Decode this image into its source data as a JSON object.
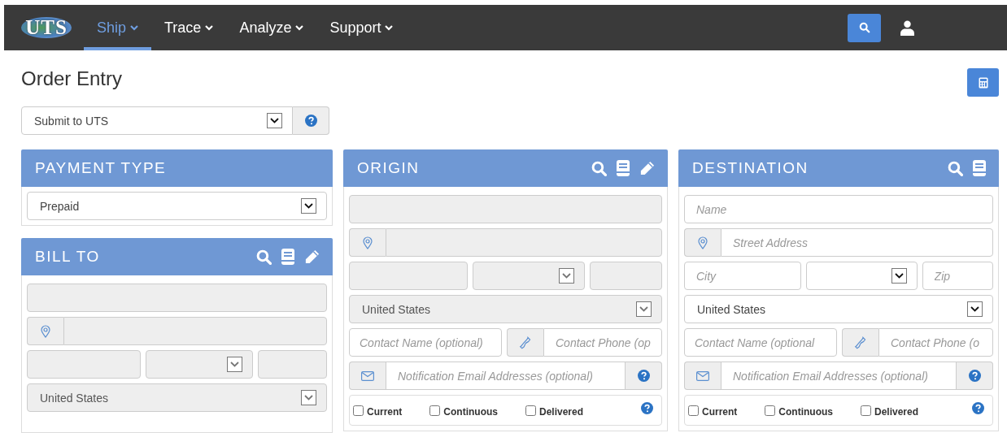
{
  "nav": {
    "logo": "UTS",
    "items": [
      {
        "label": "Ship",
        "selected": true
      },
      {
        "label": "Trace",
        "selected": false
      },
      {
        "label": "Analyze",
        "selected": false
      },
      {
        "label": "Support",
        "selected": false
      }
    ]
  },
  "title": "Order Entry",
  "submit_select": {
    "value": "Submit to UTS"
  },
  "payment_type": {
    "title": "PAYMENT TYPE",
    "select": {
      "value": "Prepaid"
    }
  },
  "panels": [
    {
      "title": "BILL TO",
      "actions": [
        {
          "kind": "search"
        },
        {
          "kind": "book"
        },
        {
          "kind": "edit"
        }
      ],
      "name": {
        "disabled": true
      },
      "street": {
        "disabled": true
      },
      "city": {
        "disabled": true
      },
      "state": {
        "disabled": true
      },
      "zip": {
        "disabled": true
      },
      "country": {
        "value": "United States",
        "disabled": true
      }
    },
    {
      "title": "ORIGIN",
      "actions": [
        {
          "kind": "search"
        },
        {
          "kind": "book"
        },
        {
          "kind": "edit"
        }
      ],
      "name": {
        "disabled": true
      },
      "street": {
        "disabled": true
      },
      "city": {
        "disabled": true
      },
      "state": {
        "disabled": true
      },
      "zip": {
        "disabled": true
      },
      "country": {
        "value": "United States",
        "disabled": true
      },
      "contact_name": {
        "placeholder": "Contact Name (optional)",
        "disabled": false
      },
      "contact_phone": {
        "placeholder": "Contact Phone (op",
        "disabled": false
      },
      "email": {
        "placeholder": "Notification Email Addresses (optional)",
        "disabled": false
      },
      "notify": [
        {
          "label": "Current",
          "checked": false
        },
        {
          "label": "Continuous",
          "checked": false
        },
        {
          "label": "Delivered",
          "checked": false
        }
      ]
    },
    {
      "title": "DESTINATION",
      "actions": [
        {
          "kind": "search"
        },
        {
          "kind": "book"
        }
      ],
      "name": {
        "placeholder": "Name",
        "disabled": false
      },
      "street": {
        "placeholder": "Street Address",
        "disabled": false
      },
      "city": {
        "placeholder": "City",
        "disabled": false
      },
      "state": {
        "disabled": false
      },
      "zip": {
        "placeholder": "Zip",
        "disabled": false
      },
      "country": {
        "value": "United States",
        "disabled": false
      },
      "contact_name": {
        "placeholder": "Contact Name (optional",
        "disabled": false
      },
      "contact_phone": {
        "placeholder": "Contact Phone (o",
        "disabled": false
      },
      "email": {
        "placeholder": "Notification Email Addresses (optional)",
        "disabled": false
      },
      "notify": [
        {
          "label": "Current",
          "checked": false
        },
        {
          "label": "Continuous",
          "checked": false
        },
        {
          "label": "Delivered",
          "checked": false
        }
      ]
    }
  ]
}
